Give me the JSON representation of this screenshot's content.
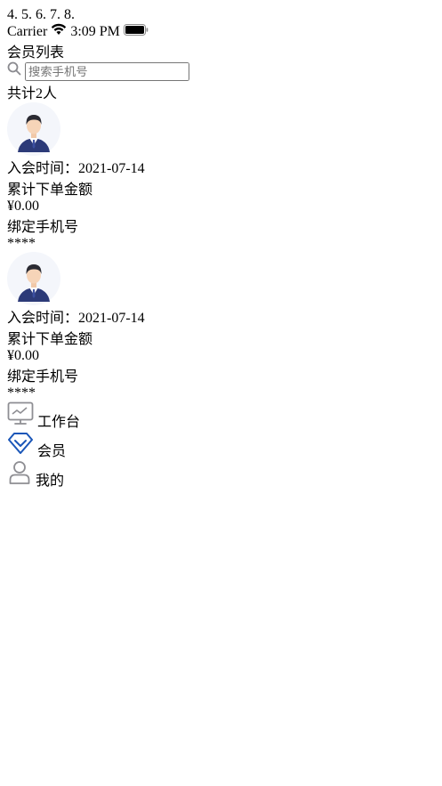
{
  "status_bar": {
    "carrier": "Carrier",
    "time": "3:09 PM"
  },
  "header": {
    "title": "会员列表"
  },
  "search": {
    "placeholder": "搜索手机号",
    "value": ""
  },
  "summary": {
    "count_text": "共计2人"
  },
  "members": [
    {
      "join_text": "入会时间：2021-07-14",
      "amount_label": "累计下单金额",
      "amount": "¥0.00",
      "phone_label": "绑定手机号",
      "phone": "****"
    },
    {
      "join_text": "入会时间：2021-07-14",
      "amount_label": "累计下单金额",
      "amount": "¥0.00",
      "phone_label": "绑定手机号",
      "phone": "****"
    }
  ],
  "tabbar": {
    "tabs": [
      {
        "label": "工作台",
        "icon": "monitor-icon"
      },
      {
        "label": "会员",
        "icon": "diamond-icon",
        "active": true
      },
      {
        "label": "我的",
        "icon": "person-icon"
      }
    ]
  },
  "colors": {
    "accent": "#1a56b8",
    "card_top": "#2196f8",
    "card_bottom": "#0a3ea8",
    "background": "#f3f3f8"
  }
}
